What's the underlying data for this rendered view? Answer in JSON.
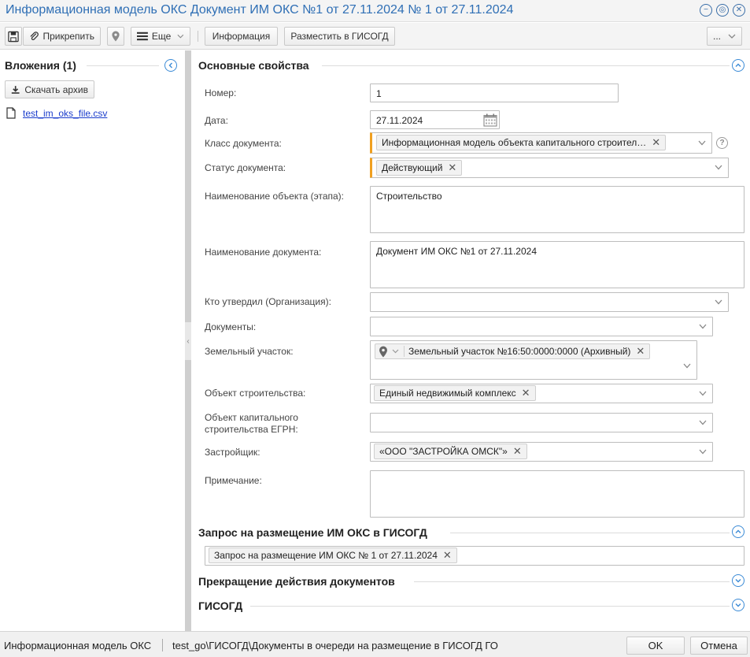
{
  "window": {
    "title": "Информационная модель ОКС Документ ИМ ОКС №1 от 27.11.2024 № 1 от 27.11.2024"
  },
  "toolbar": {
    "attach_label": "Прикрепить",
    "more_label": "Еще",
    "info_label": "Информация",
    "publish_label": "Разместить в ГИСОГД",
    "overflow_label": "..."
  },
  "attachments": {
    "title": "Вложения (1)",
    "download_label": "Скачать архив",
    "files": [
      "test_im_oks_file.csv"
    ]
  },
  "main": {
    "section_title": "Основные свойства",
    "fields": {
      "number": {
        "label": "Номер:",
        "value": "1"
      },
      "date": {
        "label": "Дата:",
        "value": "27.11.2024"
      },
      "doc_class": {
        "label": "Класс документа:",
        "value": "Информационная модель объекта капитального строител…"
      },
      "doc_status": {
        "label": "Статус документа:",
        "value": "Действующий"
      },
      "object_name": {
        "label": "Наименование объекта (этапа):",
        "value": "Строительство"
      },
      "doc_name": {
        "label": "Наименование документа:",
        "value": "Документ ИМ ОКС №1 от 27.11.2024"
      },
      "approved_by": {
        "label": "Кто утвердил (Организация):",
        "value": ""
      },
      "documents": {
        "label": "Документы:",
        "value": ""
      },
      "land_plot": {
        "label": "Земельный участок:",
        "value": "Земельный участок №16:50:0000:0000 (Архивный)"
      },
      "construction_object": {
        "label": "Объект строительства:",
        "value": "Единый недвижимый комплекс"
      },
      "egrn_object_line1": "Объект капитального",
      "egrn_object_line2": "строительства ЕГРН:",
      "developer": {
        "label": "Застройщик:",
        "value": "«ООО \"ЗАСТРОЙКА ОМСК\"»"
      },
      "note": {
        "label": "Примечание:",
        "value": ""
      }
    }
  },
  "request_section": {
    "title": "Запрос на размещение ИМ ОКС в ГИСОГД",
    "value": "Запрос на размещение ИМ ОКС № 1 от 27.11.2024"
  },
  "termination_section": {
    "title": "Прекращение действия документов"
  },
  "gisogd_section": {
    "title": "ГИСОГД"
  },
  "statusbar": {
    "left_text": "Информационная модель ОКС",
    "path_text": "test_go\\ГИСОГД\\Документы в очереди на размещение в ГИСОГД ГО",
    "ok_label": "OK",
    "cancel_label": "Отмена"
  }
}
